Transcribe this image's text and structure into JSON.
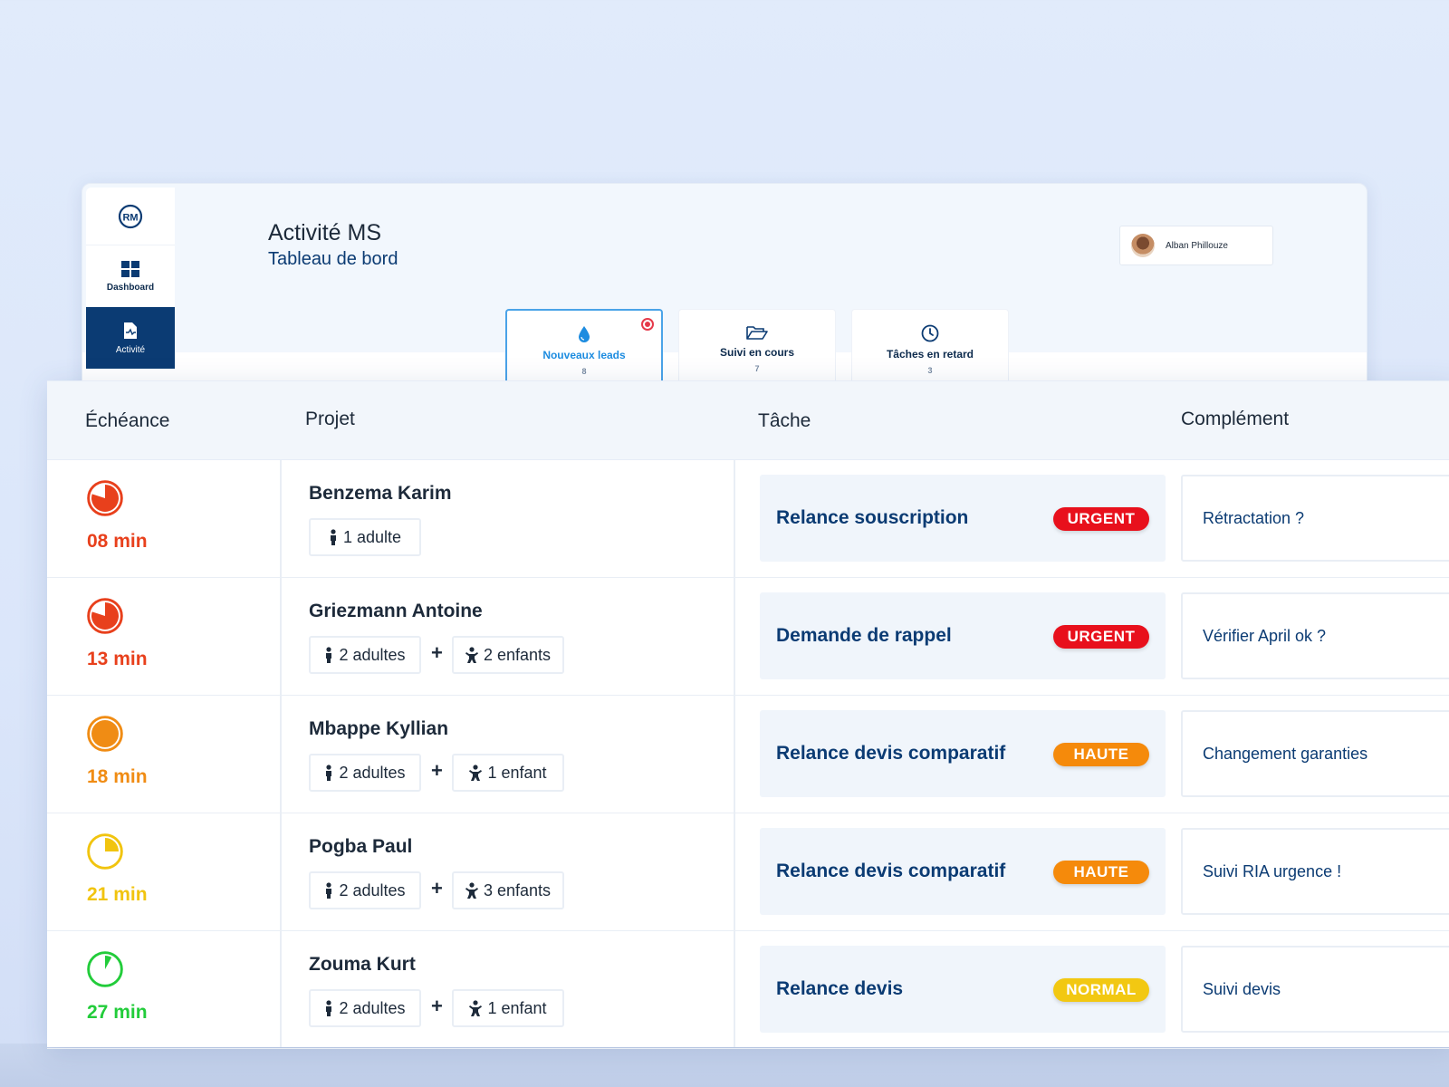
{
  "app": {
    "logo": "RM",
    "title": "Activité MS",
    "subtitle": "Tableau de bord",
    "user": "Alban Phillouze"
  },
  "sidebar": {
    "items": [
      {
        "label": "Dashboard",
        "icon": "grid-icon"
      },
      {
        "label": "Activité",
        "icon": "file-activity-icon"
      }
    ]
  },
  "tabs": [
    {
      "label": "Nouveaux leads",
      "icon": "drop-icon",
      "count": "8"
    },
    {
      "label": "Suivi en cours",
      "icon": "folder-open-icon",
      "count": "7"
    },
    {
      "label": "Tâches en retard",
      "icon": "clock-icon",
      "count": "3"
    }
  ],
  "table": {
    "headers": [
      "Échéance",
      "Projet",
      "Tâche",
      "Complément"
    ],
    "rows": [
      {
        "time": "08 min",
        "color": "#e8401c",
        "fill": 0.8,
        "name": "Benzema Karim",
        "chips": [
          "1 adulte"
        ],
        "task": "Relance souscription",
        "priority": "URGENT",
        "priority_color": "#e8101c",
        "complement": "Rétractation ?"
      },
      {
        "time": "13 min",
        "color": "#e8401c",
        "fill": 0.8,
        "name": "Griezmann Antoine",
        "chips": [
          "2 adultes",
          "2 enfants"
        ],
        "task": "Demande de rappel",
        "priority": "URGENT",
        "priority_color": "#e8101c",
        "complement": "Vérifier April ok ?"
      },
      {
        "time": "18 min",
        "color": "#f08c14",
        "fill": 1.0,
        "name": "Mbappe Kyllian",
        "chips": [
          "2 adultes",
          "1 enfant"
        ],
        "task": "Relance devis comparatif",
        "priority": "HAUTE",
        "priority_color": "#f58a0b",
        "complement": "Changement garanties"
      },
      {
        "time": "21 min",
        "color": "#f1c40f",
        "fill": 0.25,
        "name": "Pogba Paul",
        "chips": [
          "2 adultes",
          "3 enfants"
        ],
        "task": "Relance devis comparatif",
        "priority": "HAUTE",
        "priority_color": "#f58a0b",
        "complement": "Suivi RIA urgence !"
      },
      {
        "time": "27 min",
        "color": "#22cc3a",
        "fill": 0.08,
        "name": "Zouma Kurt",
        "chips": [
          "2 adultes",
          "1 enfant"
        ],
        "task": "Relance devis",
        "priority": "NORMAL",
        "priority_color": "#f2c812",
        "complement": "Suivi devis"
      }
    ]
  }
}
